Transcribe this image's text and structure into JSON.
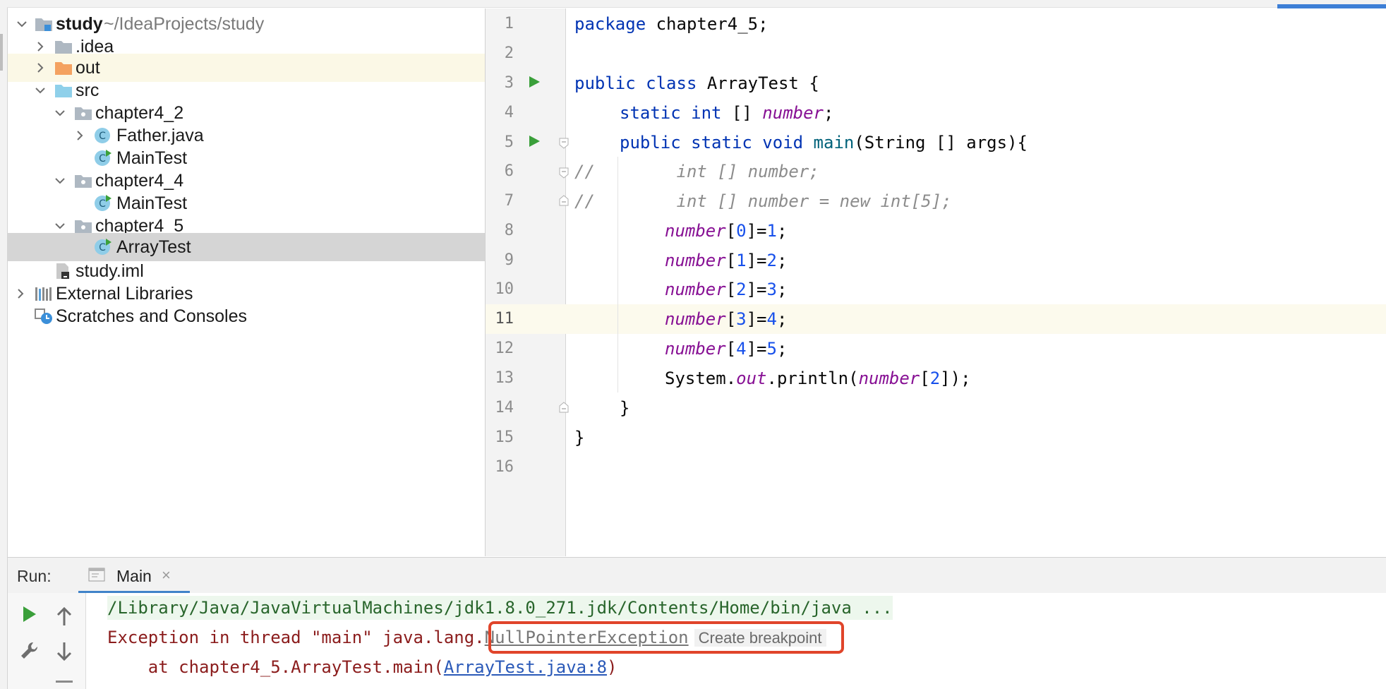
{
  "project_tree": {
    "root": {
      "name": "study",
      "path": "~/IdeaProjects/study"
    },
    "items": [
      {
        "label": ".idea"
      },
      {
        "label": "out"
      },
      {
        "label": "src"
      },
      {
        "label": "chapter4_2"
      },
      {
        "label": "Father.java"
      },
      {
        "label": "MainTest"
      },
      {
        "label": "chapter4_4"
      },
      {
        "label": "MainTest"
      },
      {
        "label": "chapter4_5"
      },
      {
        "label": "ArrayTest"
      },
      {
        "label": "study.iml"
      },
      {
        "label": "External Libraries"
      },
      {
        "label": "Scratches and Consoles"
      }
    ]
  },
  "editor": {
    "line_numbers": [
      "1",
      "2",
      "3",
      "4",
      "5",
      "6",
      "7",
      "8",
      "9",
      "10",
      "11",
      "12",
      "13",
      "14",
      "15",
      "16"
    ],
    "current_line": "11",
    "tokens": {
      "l1_kw": "package",
      "l1_rest": " chapter4_5;",
      "l3_kw": "public class",
      "l3_rest": " ArrayTest {",
      "l4_kw": "static int",
      "l4_mid": " [] ",
      "l4_fld": "number",
      "l4_end": ";",
      "l5_kw": "public static void",
      "l5_sp": " ",
      "l5_fn": "main",
      "l5_rest": "(String [] args){",
      "l6_cm": "//        int [] number;",
      "l7_cm": "//        int [] number = new int[5];",
      "arr": "number",
      "lb": "[",
      "rb": "]=",
      "semi": ";",
      "idx": [
        "0",
        "1",
        "2",
        "3",
        "4"
      ],
      "val": [
        "1",
        "2",
        "3",
        "4",
        "5"
      ],
      "l13_a": "System.",
      "l13_out": "out",
      "l13_b": ".println(",
      "l13_arr": "number",
      "l13_c": "[",
      "l13_idx": "2",
      "l13_d": "]);",
      "l14": "}",
      "l15": "}"
    }
  },
  "run_panel": {
    "label": "Run:",
    "tab_label": "Main",
    "tab_close": "×",
    "console": {
      "line1": "/Library/Java/JavaVirtualMachines/jdk1.8.0_271.jdk/Contents/Home/bin/java ...",
      "line2_prefix": "Exception in thread \"main\" ",
      "line2_pkg": "java.lang.",
      "line2_exc": "NullPointerException",
      "line2_action": "Create breakpoint",
      "line3_prefix": "    at chapter4_5.ArrayTest.main(",
      "line3_link": "ArrayTest.java:8",
      "line3_suffix": ")"
    }
  },
  "colors": {
    "keyword": "#0033b3",
    "field": "#871094",
    "number": "#1750eb",
    "error": "#8b1c1c",
    "highlight_box": "#e0442a"
  },
  "icons": [
    "chevron-right-icon",
    "chevron-down-icon",
    "folder-icon",
    "java-class-icon",
    "run-gutter-icon",
    "fold-icon",
    "rerun-icon",
    "wrench-icon",
    "up-arrow-icon",
    "down-arrow-icon",
    "library-icon",
    "scratches-icon",
    "module-file-icon"
  ]
}
